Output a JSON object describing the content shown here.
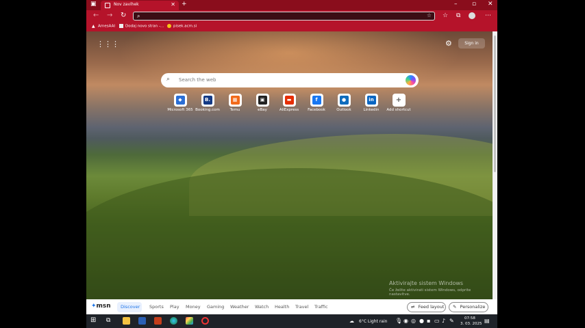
{
  "tab": {
    "title": "Nov zavihek"
  },
  "favorites": [
    {
      "label": "ArnesAAI"
    },
    {
      "label": "Dodaj novo stran -..."
    },
    {
      "label": "pisek.acm.si"
    }
  ],
  "page": {
    "signin_label": "Sign in",
    "search_placeholder": "Search the web"
  },
  "shortcuts": [
    {
      "label": "Microsoft 365",
      "glyph": "◆",
      "color": "#2b6fd6"
    },
    {
      "label": "Booking.com",
      "glyph": "B.",
      "color": "#143a85"
    },
    {
      "label": "Temu",
      "glyph": "▦",
      "color": "#f26a1b"
    },
    {
      "label": "eBay",
      "glyph": "▣",
      "color": "#222222"
    },
    {
      "label": "AliExpress",
      "glyph": "▬",
      "color": "#e62e04"
    },
    {
      "label": "Facebook",
      "glyph": "f",
      "color": "#1877f2"
    },
    {
      "label": "Outlook",
      "glyph": "●",
      "color": "#0f6cbd"
    },
    {
      "label": "Linkedin",
      "glyph": "in",
      "color": "#0a66c2"
    },
    {
      "label": "Add shortcut",
      "glyph": "+",
      "color": "#ffffff"
    }
  ],
  "watermark": {
    "title": "Aktivirajte sistem Windows",
    "subtitle": "Če želite aktivirati sistem Windows, odprite nastavitve."
  },
  "msn": {
    "logo": "msn",
    "tabs": [
      "Discover",
      "Sports",
      "Play",
      "Money",
      "Gaming",
      "Weather",
      "Watch",
      "Health",
      "Travel",
      "Traffic"
    ],
    "feed_layout": "Feed layout",
    "personalize": "Personalize"
  },
  "taskbar": {
    "weather": "6°C  Light rain",
    "time": "07:58",
    "date": "3. 03. 2025"
  }
}
